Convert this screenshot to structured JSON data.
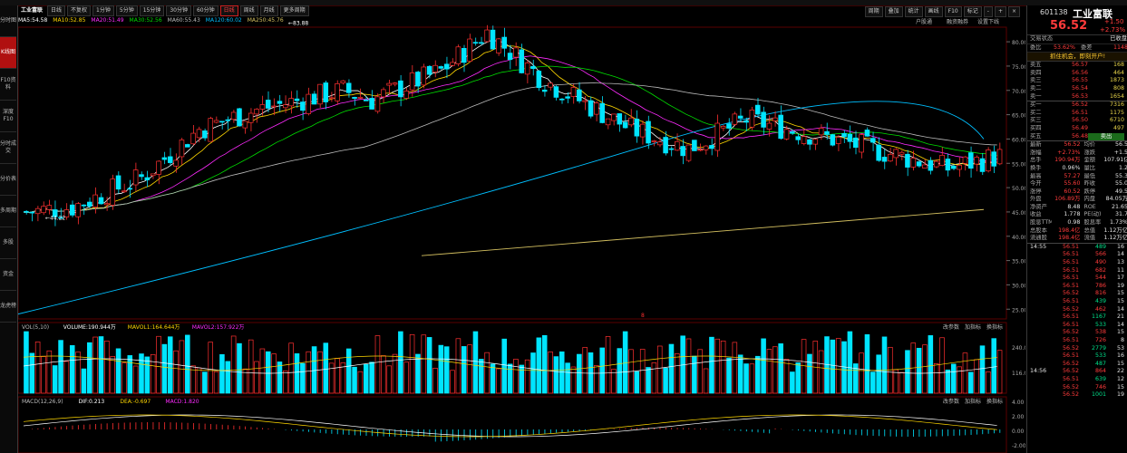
{
  "sidebar": {
    "items": [
      "分时图",
      "K线图",
      "F10资料",
      "深度F10",
      "分时成交",
      "分价表",
      "多周期",
      "多股",
      "资金",
      "龙虎榜"
    ]
  },
  "toolbar": {
    "name": "工业富联",
    "modes": [
      "日线",
      "不复权"
    ],
    "periods": [
      "1分钟",
      "5分钟",
      "15分钟",
      "30分钟",
      "60分钟",
      "日线",
      "周线",
      "月线",
      "更多周期"
    ],
    "active_period": "日线",
    "right_buttons": [
      "周期",
      "叠加",
      "统计",
      "画线",
      "F10",
      "标记",
      "-",
      "+",
      "×"
    ],
    "sub_buttons": [
      "户股通",
      "融资融券",
      "设置下线"
    ]
  },
  "ma_legend": [
    {
      "label": "MA5:",
      "value": "54.58",
      "color": "#ffffff"
    },
    {
      "label": "MA10:",
      "value": "52.85",
      "color": "#ffd700"
    },
    {
      "label": "MA20:",
      "value": "51.49",
      "color": "#ff2bff"
    },
    {
      "label": "MA30:",
      "value": "52.56",
      "color": "#00dd00"
    },
    {
      "label": "MA60:",
      "value": "55.43",
      "color": "#bbbbbb"
    },
    {
      "label": "MA120:",
      "value": "60.02",
      "color": "#00bfff"
    },
    {
      "label": "MA250:",
      "value": "45.76",
      "color": "#d4c060"
    }
  ],
  "vol_legend": {
    "prefix": "VOL(5,10)",
    "volume": "VOLUME:190.944万",
    "mavol1": "MAVOL1:164.644万",
    "mavol2": "MAVOL2:157.922万"
  },
  "macd_legend": {
    "prefix": "MACD(12,26,9)",
    "dif": "DIF:0.213",
    "dea": "DEA:-0.697",
    "macd": "MACD:1.820"
  },
  "panel_buttons": [
    "改参数",
    "加指标",
    "换指标"
  ],
  "price_axis": [
    "80.00",
    "75.00",
    "70.00",
    "65.00",
    "60.00",
    "55.00",
    "50.00",
    "45.00",
    "40.00",
    "35.00",
    "30.00",
    "25.00"
  ],
  "vol_axis": [
    "240.00",
    "116.00"
  ],
  "macd_axis": [
    "4.00",
    "2.00",
    "0.00",
    "-2.00"
  ],
  "annotations": {
    "high": "83.88",
    "low": "44.22",
    "mark": "8"
  },
  "quote": {
    "code": "601138",
    "name": "工业富联",
    "price": "56.52",
    "change": "+1.50",
    "pct": "+2.73%",
    "status_label": "交易状态",
    "status_value": "已收盘",
    "wei_label": "委比",
    "wei_value": "53.62%",
    "weicha_label": "委差",
    "weicha_value": "1148",
    "banner": "抓住机会，即刻开户!",
    "asks": [
      [
        "卖五",
        "56.57",
        "168"
      ],
      [
        "卖四",
        "56.56",
        "464"
      ],
      [
        "卖三",
        "56.55",
        "1873"
      ],
      [
        "卖二",
        "56.54",
        "808"
      ],
      [
        "卖一",
        "56.53",
        "1654"
      ]
    ],
    "bids": [
      [
        "买一",
        "56.52",
        "7316"
      ],
      [
        "买二",
        "56.51",
        "1175"
      ],
      [
        "买三",
        "56.50",
        "6710"
      ],
      [
        "买四",
        "56.49",
        "497"
      ],
      [
        "买五",
        "56.48",
        "卖出"
      ]
    ],
    "stats": [
      [
        "最新",
        "56.52",
        "均价",
        "56.5"
      ],
      [
        "涨幅",
        "+2.73%",
        "涨跌",
        "+1.5"
      ],
      [
        "总手",
        "190.94万",
        "金额",
        "107.91亿"
      ],
      [
        "换手",
        "0.96%",
        "量比",
        "1.2"
      ],
      [
        "最高",
        "57.27",
        "最低",
        "55.3"
      ],
      [
        "今开",
        "55.60",
        "昨收",
        "55.0"
      ],
      [
        "涨停",
        "60.52",
        "跌停",
        "49.5"
      ],
      [
        "外盘",
        "106.89万",
        "内盘",
        "84.05万"
      ],
      [
        "净资产",
        "8.48",
        "ROE",
        "21.65"
      ],
      [
        "收益",
        "1.778",
        "PE(动)",
        "31.7"
      ],
      [
        "股息TTM",
        "0.98",
        "股息率",
        "1.73%"
      ],
      [
        "总股本",
        "198.4亿",
        "总值",
        "1.12万亿"
      ],
      [
        "流通股",
        "198.4亿",
        "流值",
        "1.12万亿"
      ]
    ],
    "ticks": [
      [
        "14:55",
        "56.51",
        "489",
        "16"
      ],
      [
        "",
        "56.51",
        "566",
        "14"
      ],
      [
        "",
        "56.51",
        "490",
        "13"
      ],
      [
        "",
        "56.51",
        "682",
        "11"
      ],
      [
        "",
        "56.51",
        "544",
        "17"
      ],
      [
        "",
        "56.51",
        "786",
        "19"
      ],
      [
        "",
        "56.52",
        "816",
        "15"
      ],
      [
        "",
        "56.51",
        "439",
        "15"
      ],
      [
        "",
        "56.52",
        "462",
        "14"
      ],
      [
        "",
        "56.51",
        "1167",
        "21"
      ],
      [
        "",
        "56.51",
        "533",
        "14"
      ],
      [
        "",
        "56.52",
        "538",
        "15"
      ],
      [
        "",
        "56.51",
        "726",
        "8"
      ],
      [
        "",
        "56.52",
        "2779",
        "53"
      ],
      [
        "",
        "56.51",
        "533",
        "16"
      ],
      [
        "",
        "56.52",
        "487",
        "15"
      ],
      [
        "14:56",
        "56.52",
        "864",
        "22"
      ],
      [
        "",
        "56.51",
        "639",
        "12"
      ],
      [
        "",
        "56.52",
        "746",
        "15"
      ],
      [
        "",
        "56.52",
        "1001",
        "19"
      ]
    ]
  }
}
